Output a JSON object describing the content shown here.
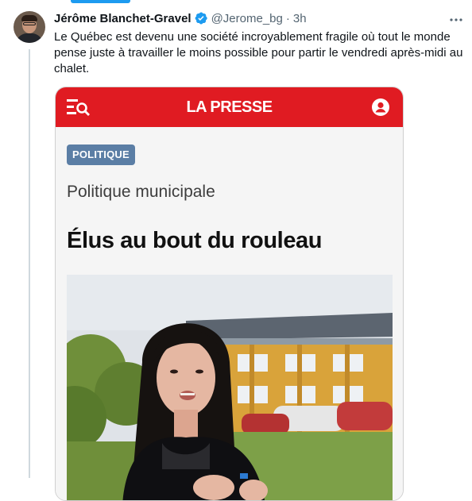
{
  "tweet": {
    "author_name": "Jérôme Blanchet-Gravel",
    "handle": "@Jerome_bg",
    "separator": "·",
    "time": "3h",
    "text": "Le Québec est devenu une société incroyablement fragile où tout le monde pense juste à travailler le moins possible pour partir le vendredi après-midi au chalet.",
    "verified": true
  },
  "card": {
    "brand": "LA PRESSE",
    "section_badge": "POLITIQUE",
    "kicker": "Politique municipale",
    "headline": "Élus au bout du rouleau",
    "brand_color": "#e01b22",
    "badge_color": "#5b7ea5"
  },
  "icons": {
    "verified": "verified-badge-icon",
    "more": "more-options-icon",
    "menu_search": "menu-search-icon",
    "account": "account-icon"
  },
  "colors": {
    "accent": "#1d9bf0",
    "text": "#0f1419",
    "secondary_text": "#536471"
  }
}
